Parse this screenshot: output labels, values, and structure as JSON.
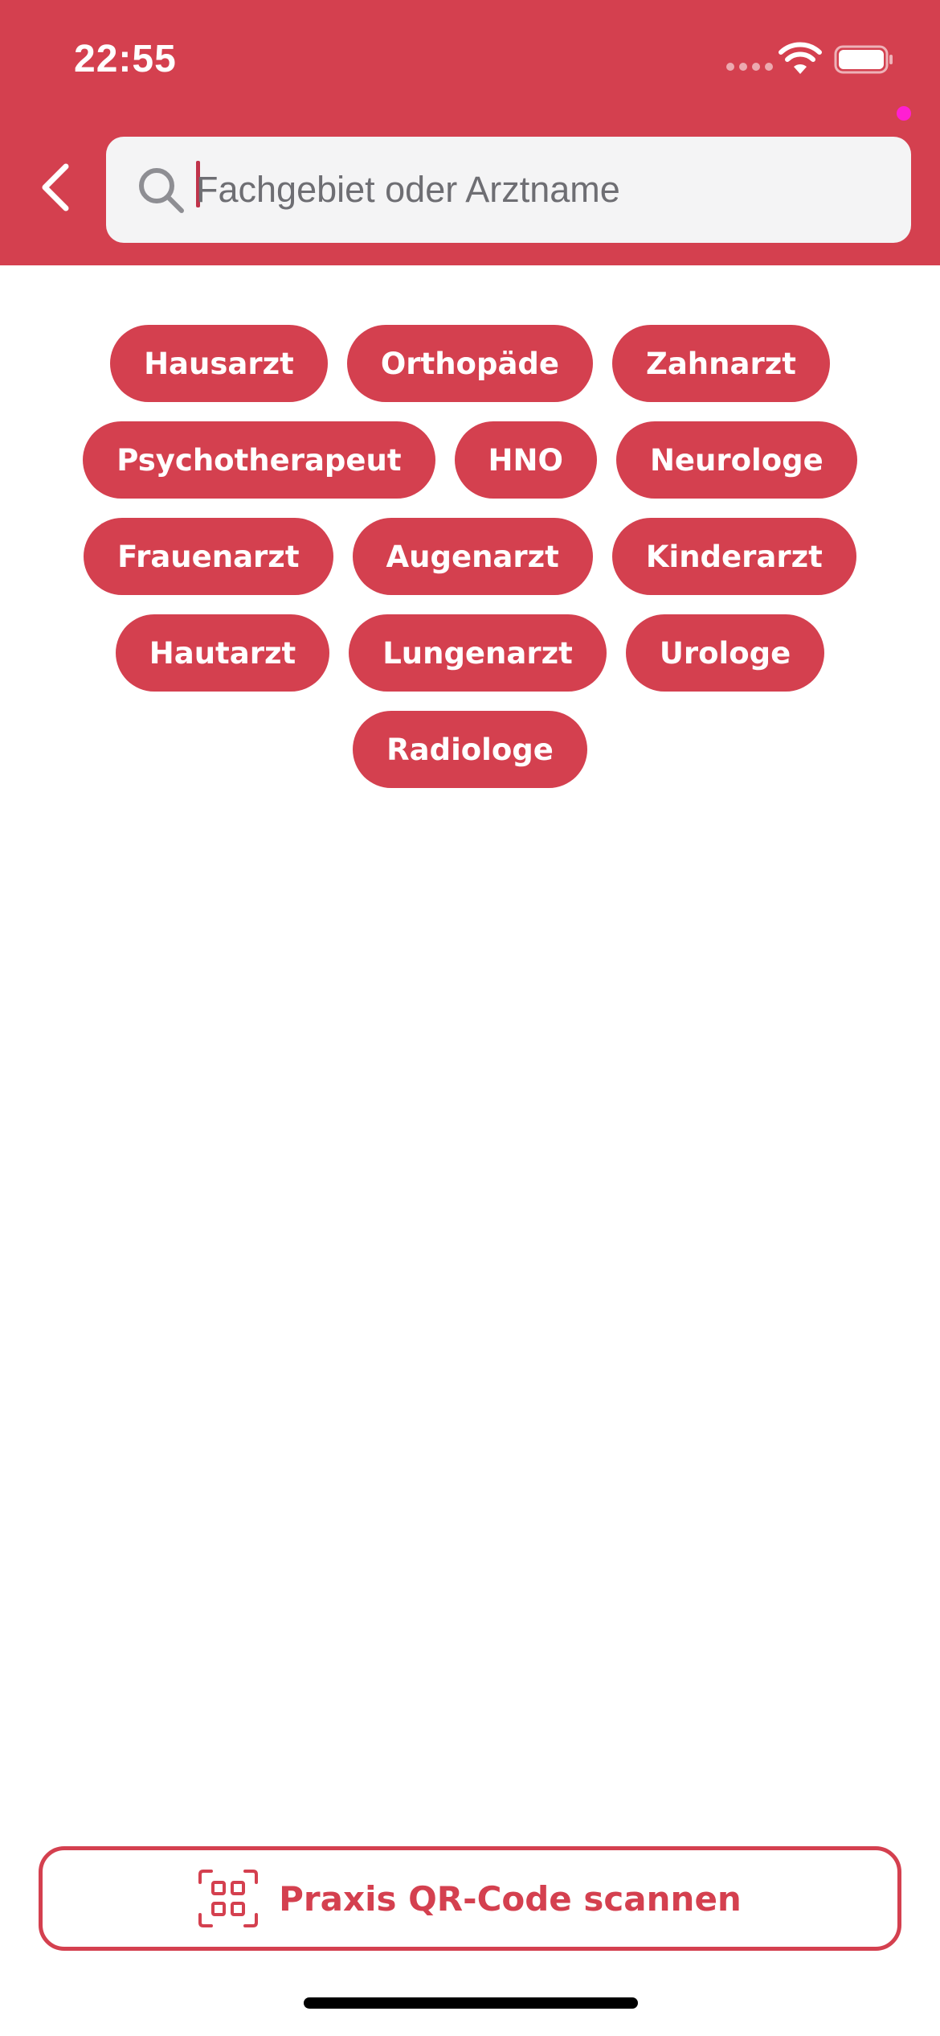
{
  "status_bar": {
    "time": "22:55",
    "icons": [
      "signal-dots-icon",
      "wifi-icon",
      "battery-icon"
    ]
  },
  "header": {
    "back_icon": "chevron-left-icon",
    "search": {
      "placeholder": "Fachgebiet oder Arztname",
      "value": "",
      "icon": "search-icon"
    }
  },
  "specialties": {
    "rows": [
      [
        "Hausarzt",
        "Orthopäde",
        "Zahnarzt"
      ],
      [
        "Psychotherapeut",
        "HNO",
        "Neurologe"
      ],
      [
        "Frauenarzt",
        "Augenarzt",
        "Kinderarzt"
      ],
      [
        "Hautarzt",
        "Lungenarzt",
        "Urologe"
      ],
      [
        "Radiologe"
      ]
    ]
  },
  "qr_button": {
    "label": "Praxis QR-Code scannen",
    "icon": "qr-code-scan-icon"
  },
  "colors": {
    "brand": "#d4404f",
    "search_bg": "#f4f4f5",
    "placeholder": "#6e6e73"
  }
}
